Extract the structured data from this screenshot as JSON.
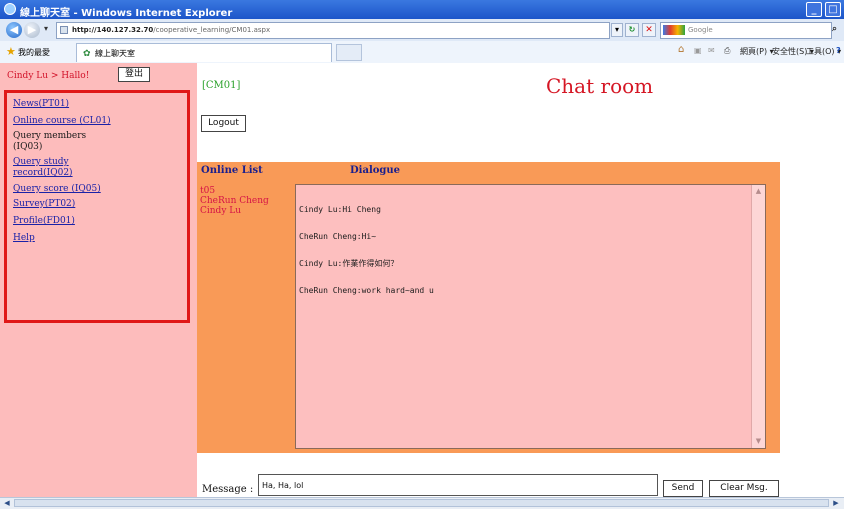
{
  "browser": {
    "window_title": "線上聊天室 - Windows Internet Explorer",
    "url_host": "http://140.127.32.70",
    "url_path": "/cooperative_learning/CM01.aspx",
    "search_placeholder": "Google",
    "favorites_label": "我的最愛",
    "tab_title": "線上聊天室",
    "commands": {
      "page": "網頁(P) ▾",
      "safety": "安全性(S) ▾",
      "tools": "工具(O) ▾"
    },
    "icons": {
      "back": "back-arrow-icon",
      "forward": "forward-arrow-icon",
      "refresh": "refresh-icon",
      "stop": "stop-icon",
      "home": "home-icon",
      "print": "print-icon",
      "help": "help-icon"
    }
  },
  "sidebar": {
    "user_greeting": "Cindy Lu > Hallo!",
    "logout_label": "登出",
    "items": [
      {
        "label": "News(PT01)",
        "link": true
      },
      {
        "label": "Online course (CL01)",
        "link": true
      },
      {
        "label": "Query members (IQ03)",
        "link": false
      },
      {
        "label": "Query study record(IQ02)",
        "link": true
      },
      {
        "label": "Query score (IQ05)",
        "link": true
      },
      {
        "label": "Survey(PT02)",
        "link": true
      },
      {
        "label": "Profile(FD01)",
        "link": true
      },
      {
        "label": "Help",
        "link": true
      }
    ]
  },
  "page": {
    "code": "[CM01]",
    "title": "Chat room",
    "logout_label": "Logout"
  },
  "chat": {
    "online_header": "Online List",
    "dialogue_header": "Dialogue",
    "online_users": [
      "t05",
      "CheRun Cheng",
      "Cindy Lu"
    ],
    "messages": [
      "Cindy Lu:Hi Cheng",
      "CheRun Cheng:Hi~",
      "Cindy Lu:作業作得如何？",
      "CheRun Cheng:work hard~and u"
    ]
  },
  "composer": {
    "message_label": "Message :",
    "message_value": "Ha, Ha, lol",
    "send_label": "Send",
    "clear_label": "Clear Msg."
  },
  "colors": {
    "sidebar_bg": "#fdbcbc",
    "chat_panel_bg": "#f99a57",
    "dialogue_bg": "#fdbfbf",
    "title_red": "#d51624",
    "highlight_border": "#e01818"
  }
}
